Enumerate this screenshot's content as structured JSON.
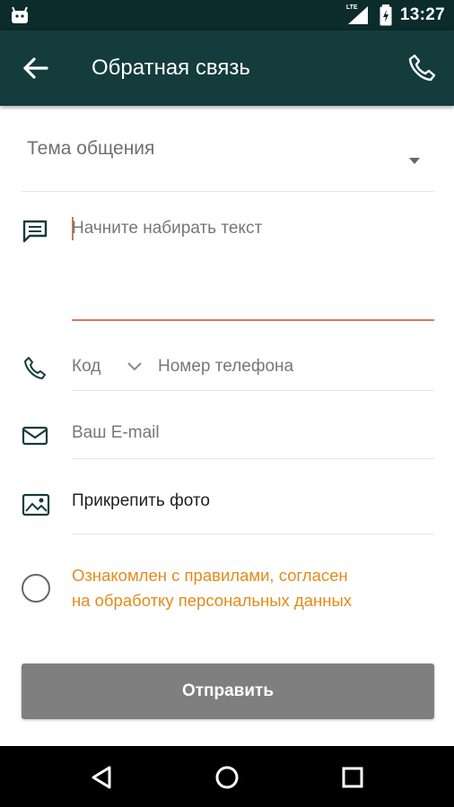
{
  "status_bar": {
    "time": "13:27",
    "network_label": "LTE",
    "icons": [
      "android-icon",
      "signal-icon",
      "battery-charging-icon"
    ]
  },
  "toolbar": {
    "title": "Обратная связь",
    "icons": [
      "arrow-back-icon",
      "phone-icon"
    ]
  },
  "form": {
    "topic_label": "Тема общения",
    "message_placeholder": "Начните набирать текст",
    "phone_code_label": "Код",
    "phone_number_placeholder": "Номер телефона",
    "email_placeholder": "Ваш E-mail",
    "attach_photo_label": "Прикрепить фото",
    "consent_line1": "Ознакомлен с правилами, согласен",
    "consent_line2": "на обработку персональных данных",
    "submit_label": "Отправить",
    "accent_color": "#e38b1a",
    "teal_color": "#143c3c"
  },
  "nav_bar": {
    "buttons": [
      "back-triangle-icon",
      "home-circle-icon",
      "recents-square-icon"
    ]
  }
}
